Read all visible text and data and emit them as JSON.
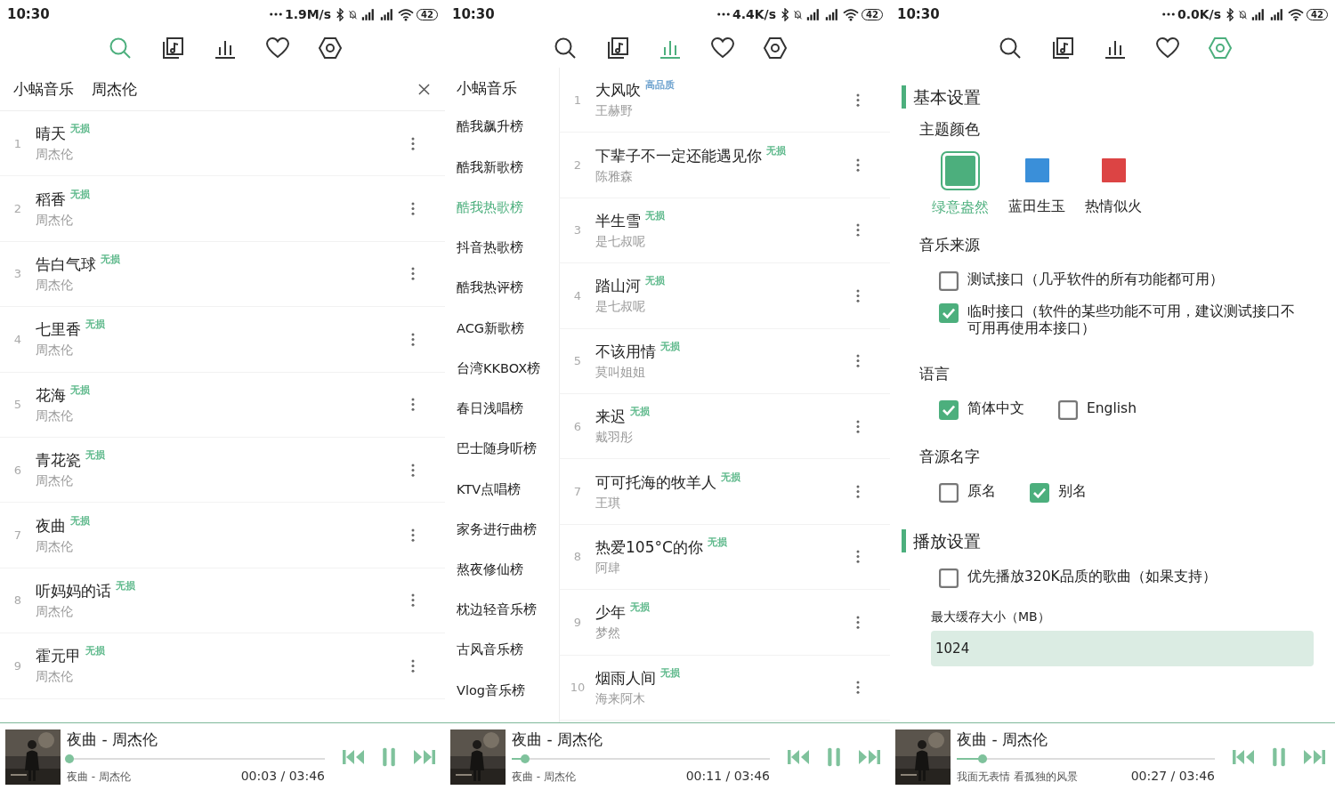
{
  "screens": [
    {
      "status": {
        "time": "10:30",
        "speed": "1.9M/s",
        "battery": "42"
      },
      "nav": [
        {
          "kind": "search",
          "selected": true
        },
        {
          "kind": "music-file",
          "selected": false
        },
        {
          "kind": "chart",
          "selected": false
        },
        {
          "kind": "heart",
          "selected": false
        },
        {
          "kind": "settings",
          "selected": false
        }
      ],
      "view": {
        "kind": "search",
        "source": "小蜗音乐",
        "query": "周杰伦",
        "songs": [
          {
            "index": "1",
            "title": "晴天",
            "tag": "无损",
            "color": "#5cb88a",
            "artist": "周杰伦"
          },
          {
            "index": "2",
            "title": "稻香",
            "tag": "无损",
            "color": "#5cb88a",
            "artist": "周杰伦"
          },
          {
            "index": "3",
            "title": "告白气球",
            "tag": "无损",
            "color": "#5cb88a",
            "artist": "周杰伦"
          },
          {
            "index": "4",
            "title": "七里香",
            "tag": "无损",
            "color": "#5cb88a",
            "artist": "周杰伦"
          },
          {
            "index": "5",
            "title": "花海",
            "tag": "无损",
            "color": "#5cb88a",
            "artist": "周杰伦"
          },
          {
            "index": "6",
            "title": "青花瓷",
            "tag": "无损",
            "color": "#5cb88a",
            "artist": "周杰伦"
          },
          {
            "index": "7",
            "title": "夜曲",
            "tag": "无损",
            "color": "#5cb88a",
            "artist": "周杰伦"
          },
          {
            "index": "8",
            "title": "听妈妈的话",
            "tag": "无损",
            "color": "#5cb88a",
            "artist": "周杰伦"
          },
          {
            "index": "9",
            "title": "霍元甲",
            "tag": "无损",
            "color": "#5cb88a",
            "artist": "周杰伦"
          }
        ]
      },
      "player": {
        "title": "夜曲 - 周杰伦",
        "subtitle": "夜曲 - 周杰伦",
        "time": "00:03 / 03:46",
        "level": 0.01
      }
    },
    {
      "status": {
        "time": "10:30",
        "speed": "4.4K/s",
        "battery": "42"
      },
      "nav": [
        {
          "kind": "search",
          "selected": false
        },
        {
          "kind": "music-file",
          "selected": false
        },
        {
          "kind": "chart",
          "selected": true
        },
        {
          "kind": "heart",
          "selected": false
        },
        {
          "kind": "settings",
          "selected": false
        }
      ],
      "view": {
        "kind": "charts",
        "source": "小蜗音乐",
        "charts": [
          {
            "name": "酷我飙升榜",
            "selected": false
          },
          {
            "name": "酷我新歌榜",
            "selected": false
          },
          {
            "name": "酷我热歌榜",
            "selected": true
          },
          {
            "name": "抖音热歌榜",
            "selected": false
          },
          {
            "name": "酷我热评榜",
            "selected": false
          },
          {
            "name": "ACG新歌榜",
            "selected": false
          },
          {
            "name": "台湾KKBOX榜",
            "selected": false
          },
          {
            "name": "春日浅唱榜",
            "selected": false
          },
          {
            "name": "巴士随身听榜",
            "selected": false
          },
          {
            "name": "KTV点唱榜",
            "selected": false
          },
          {
            "name": "家务进行曲榜",
            "selected": false
          },
          {
            "name": "熬夜修仙榜",
            "selected": false
          },
          {
            "name": "枕边轻音乐榜",
            "selected": false
          },
          {
            "name": "古风音乐榜",
            "selected": false
          },
          {
            "name": "Vlog音乐榜",
            "selected": false
          }
        ],
        "songs": [
          {
            "index": "1",
            "title": "大风吹",
            "tag": "高品质",
            "color": "#6fa3cf",
            "artist": "王赫野"
          },
          {
            "index": "2",
            "title": "下辈子不一定还能遇见你",
            "tag": "无损",
            "color": "#5cb88a",
            "artist": "陈雅森"
          },
          {
            "index": "3",
            "title": "半生雪",
            "tag": "无损",
            "color": "#5cb88a",
            "artist": "是七叔呢"
          },
          {
            "index": "4",
            "title": "踏山河",
            "tag": "无损",
            "color": "#5cb88a",
            "artist": "是七叔呢"
          },
          {
            "index": "5",
            "title": "不该用情",
            "tag": "无损",
            "color": "#5cb88a",
            "artist": "莫叫姐姐"
          },
          {
            "index": "6",
            "title": "来迟",
            "tag": "无损",
            "color": "#5cb88a",
            "artist": "戴羽彤"
          },
          {
            "index": "7",
            "title": "可可托海的牧羊人",
            "tag": "无损",
            "color": "#5cb88a",
            "artist": "王琪"
          },
          {
            "index": "8",
            "title": "热爱105°C的你",
            "tag": "无损",
            "color": "#5cb88a",
            "artist": "阿肆"
          },
          {
            "index": "9",
            "title": "少年",
            "tag": "无损",
            "color": "#5cb88a",
            "artist": "梦然"
          },
          {
            "index": "10",
            "title": "烟雨人间",
            "tag": "无损",
            "color": "#5cb88a",
            "artist": "海来阿木"
          }
        ]
      },
      "player": {
        "title": "夜曲 - 周杰伦",
        "subtitle": "夜曲 - 周杰伦",
        "time": "00:11 / 03:46",
        "level": 0.05
      }
    },
    {
      "status": {
        "time": "10:30",
        "speed": "0.0K/s",
        "battery": "42"
      },
      "nav": [
        {
          "kind": "search",
          "selected": false
        },
        {
          "kind": "music-file",
          "selected": false
        },
        {
          "kind": "chart",
          "selected": false
        },
        {
          "kind": "heart",
          "selected": false
        },
        {
          "kind": "settings",
          "selected": true
        }
      ],
      "view": {
        "kind": "settings",
        "sections": [
          {
            "title": "基本设置",
            "groups": [
              {
                "kind": "themes",
                "label": "主题颜色",
                "options": [
                  {
                    "name": "绿意盎然",
                    "color": "#4caf7d",
                    "selected": true
                  },
                  {
                    "name": "蓝田生玉",
                    "color": "#3a8fd9",
                    "selected": false
                  },
                  {
                    "name": "热情似火",
                    "color": "#dc4444",
                    "selected": false
                  }
                ]
              },
              {
                "kind": "check-list",
                "label": "音乐来源",
                "options": [
                  {
                    "text": "测试接口（几乎软件的所有功能都可用）",
                    "checked": false
                  },
                  {
                    "text": "临时接口（软件的某些功能不可用，建议测试接口不可用再使用本接口）",
                    "checked": true
                  }
                ]
              },
              {
                "kind": "check-row",
                "label": "语言",
                "options": [
                  {
                    "text": "简体中文",
                    "checked": true
                  },
                  {
                    "text": "English",
                    "checked": false
                  }
                ]
              },
              {
                "kind": "check-row",
                "label": "音源名字",
                "options": [
                  {
                    "text": "原名",
                    "checked": false
                  },
                  {
                    "text": "别名",
                    "checked": true
                  }
                ]
              }
            ]
          },
          {
            "title": "播放设置",
            "groups": [
              {
                "kind": "check-list",
                "options": [
                  {
                    "text": "优先播放320K品质的歌曲（如果支持）",
                    "checked": false
                  }
                ]
              },
              {
                "kind": "field",
                "label": "最大缓存大小（MB）",
                "value": "1024"
              }
            ]
          }
        ]
      },
      "player": {
        "title": "夜曲 - 周杰伦",
        "subtitle": "我面无表情 看孤独的风景",
        "time": "00:27 / 03:46",
        "level": 0.1
      }
    }
  ]
}
